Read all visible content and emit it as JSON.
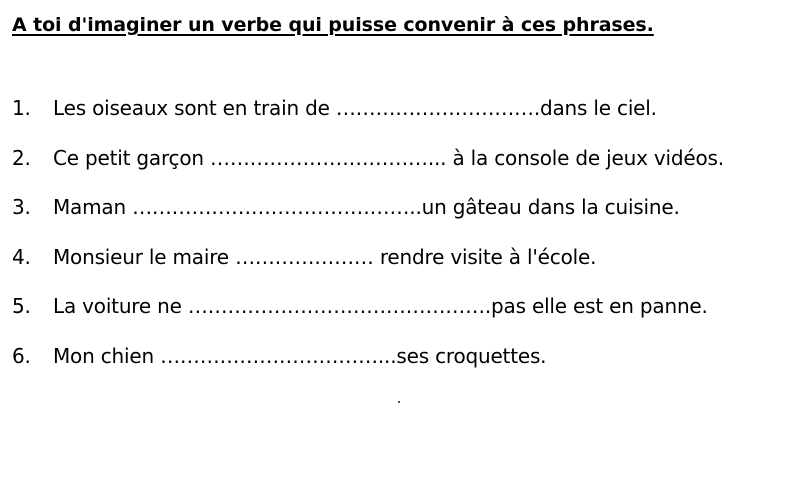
{
  "title": "A toi d'imaginer un verbe qui puisse convenir à ces phrases.",
  "items": [
    {
      "number": "1.",
      "text": "Les oiseaux sont en train de ………………………….dans le ciel."
    },
    {
      "number": "2.",
      "text": "Ce petit garçon ……………………………... à la console de jeux vidéos."
    },
    {
      "number": "3.",
      "text": "Maman ……………………………………..un gâteau dans la cuisine."
    },
    {
      "number": "4.",
      "text": "Monsieur le maire ………………… rendre visite à l'école."
    },
    {
      "number": "5.",
      "text": "La voiture ne ……………………………………….pas elle est en panne."
    },
    {
      "number": "6.",
      "text": "Mon chien ……………………………...ses croquettes."
    }
  ]
}
